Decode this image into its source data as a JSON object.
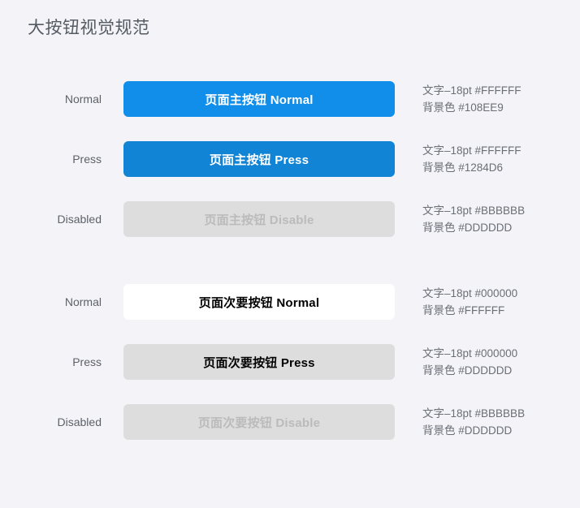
{
  "page": {
    "title": "大按钮视觉规范",
    "background_color": "#F4F4F8",
    "title_color": "#555B63"
  },
  "groups": [
    {
      "name": "primary-button-group",
      "rows": [
        {
          "state_label": "Normal",
          "button_label": "页面主按钮 Normal",
          "variant": "primary-normal",
          "text_spec": "文字–18pt #FFFFFF",
          "background_spec": "背景色 #108EE9",
          "text_color": "#FFFFFF",
          "background_color": "#108EE9"
        },
        {
          "state_label": "Press",
          "button_label": "页面主按钮 Press",
          "variant": "primary-press",
          "text_spec": "文字–18pt #FFFFFF",
          "background_spec": "背景色 #1284D6",
          "text_color": "#FFFFFF",
          "background_color": "#1284D6"
        },
        {
          "state_label": "Disabled",
          "button_label": "页面主按钮 Disable",
          "variant": "primary-disabled",
          "text_spec": "文字–18pt #BBBBBB",
          "background_spec": "背景色 #DDDDDD",
          "text_color": "#BBBBBB",
          "background_color": "#DDDDDD"
        }
      ]
    },
    {
      "name": "secondary-button-group",
      "rows": [
        {
          "state_label": "Normal",
          "button_label": "页面次要按钮 Normal",
          "variant": "secondary-normal",
          "text_spec": "文字–18pt #000000",
          "background_spec": "背景色 #FFFFFF",
          "text_color": "#000000",
          "background_color": "#FFFFFF"
        },
        {
          "state_label": "Press",
          "button_label": "页面次要按钮 Press",
          "variant": "secondary-press",
          "text_spec": "文字–18pt #000000",
          "background_spec": "背景色 #DDDDDD",
          "text_color": "#000000",
          "background_color": "#DDDDDD"
        },
        {
          "state_label": "Disabled",
          "button_label": "页面次要按钮 Disable",
          "variant": "secondary-disabled",
          "text_spec": "文字–18pt #BBBBBB",
          "background_spec": "背景色 #DDDDDD",
          "text_color": "#BBBBBB",
          "background_color": "#DDDDDD"
        }
      ]
    }
  ]
}
